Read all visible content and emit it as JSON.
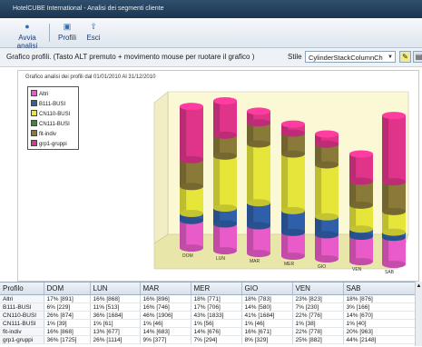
{
  "window": {
    "title": "HotelCUBE International - Analisi dei segmenti cliente"
  },
  "toolbar": {
    "items": [
      {
        "label": "Avvia analisi",
        "icon": "play-icon"
      },
      {
        "label": "Profili",
        "icon": "profile-icon"
      },
      {
        "label": "Esci",
        "icon": "exit-icon"
      }
    ]
  },
  "options": {
    "label": "Grafico profili.  (Tasto ALT premuto + movimento mouse per ruotare il grafico )",
    "stile_label": "Stile",
    "stile_value": "CylinderStackColumnCh"
  },
  "colors": {
    "Altri": "#e85bc8",
    "B111-BUSI": "#2f5fa8",
    "CN110-BUSI": "#e6e63a",
    "CN111-BUSI": "#3c8a2c",
    "fit-indiv": "#8a7a3a",
    "grp1-gruppi": "#e0348a",
    "floor": "#e8e6a8",
    "wall": "#fbf8d6"
  },
  "chart_data": {
    "type": "bar",
    "title": "Grafico analisi dei profili dal  01/01/2010 Al 31/12/2010",
    "categories": [
      "DOM",
      "LUN",
      "MAR",
      "MER",
      "GIO",
      "VEN",
      "SAB"
    ],
    "series": [
      {
        "name": "Altri",
        "values": [
          891,
          868,
          896,
          771,
          783,
          823,
          876
        ]
      },
      {
        "name": "B111-BUSI",
        "values": [
          229,
          513,
          746,
          706,
          580,
          230,
          166
        ]
      },
      {
        "name": "CN110-BUSI",
        "values": [
          874,
          1684,
          1906,
          1833,
          1684,
          776,
          670
        ]
      },
      {
        "name": "CN111-BUSI",
        "values": [
          39,
          61,
          46,
          56,
          46,
          38,
          40
        ]
      },
      {
        "name": "fit-indiv",
        "values": [
          868,
          677,
          683,
          676,
          671,
          778,
          963
        ]
      },
      {
        "name": "grp1-gruppi",
        "values": [
          1725,
          1114,
          377,
          294,
          329,
          882,
          2148
        ]
      }
    ],
    "stack_order": [
      "Altri",
      "B111-BUSI",
      "CN110-BUSI",
      "fit-indiv",
      "grp1-gruppi"
    ]
  },
  "table": {
    "headers": [
      "Profilo",
      "DOM",
      "LUN",
      "MAR",
      "MER",
      "GIO",
      "VEN",
      "SAB"
    ],
    "rows": [
      [
        "Altri",
        "17% [891]",
        "16% [868]",
        "16% [896]",
        "18% [771]",
        "18% [783]",
        "23% [823]",
        "18% [876]"
      ],
      [
        "B111-BUSI",
        "6% [229]",
        "11% [513]",
        "16% [746]",
        "17% [706]",
        "14% [580]",
        "7% [230]",
        "3% [166]"
      ],
      [
        "CN110-BUSI",
        "26% [874]",
        "36% [1684]",
        "46% [1906]",
        "43% [1833]",
        "41% [1684]",
        "22% [776]",
        "14% [670]"
      ],
      [
        "CN111-BUSI",
        "1% [39]",
        "1% [61]",
        "1% [46]",
        "1% [56]",
        "1% [46]",
        "1% [38]",
        "1% [40]"
      ],
      [
        "fit-indiv",
        "16% [868]",
        "13% [677]",
        "14% [683]",
        "14% [676]",
        "16% [671]",
        "22% [778]",
        "20% [963]"
      ],
      [
        "grp1-gruppi",
        "36% [1725]",
        "26% [1114]",
        "9% [377]",
        "7% [294]",
        "8% [329]",
        "25% [882]",
        "44% [2148]"
      ]
    ]
  }
}
